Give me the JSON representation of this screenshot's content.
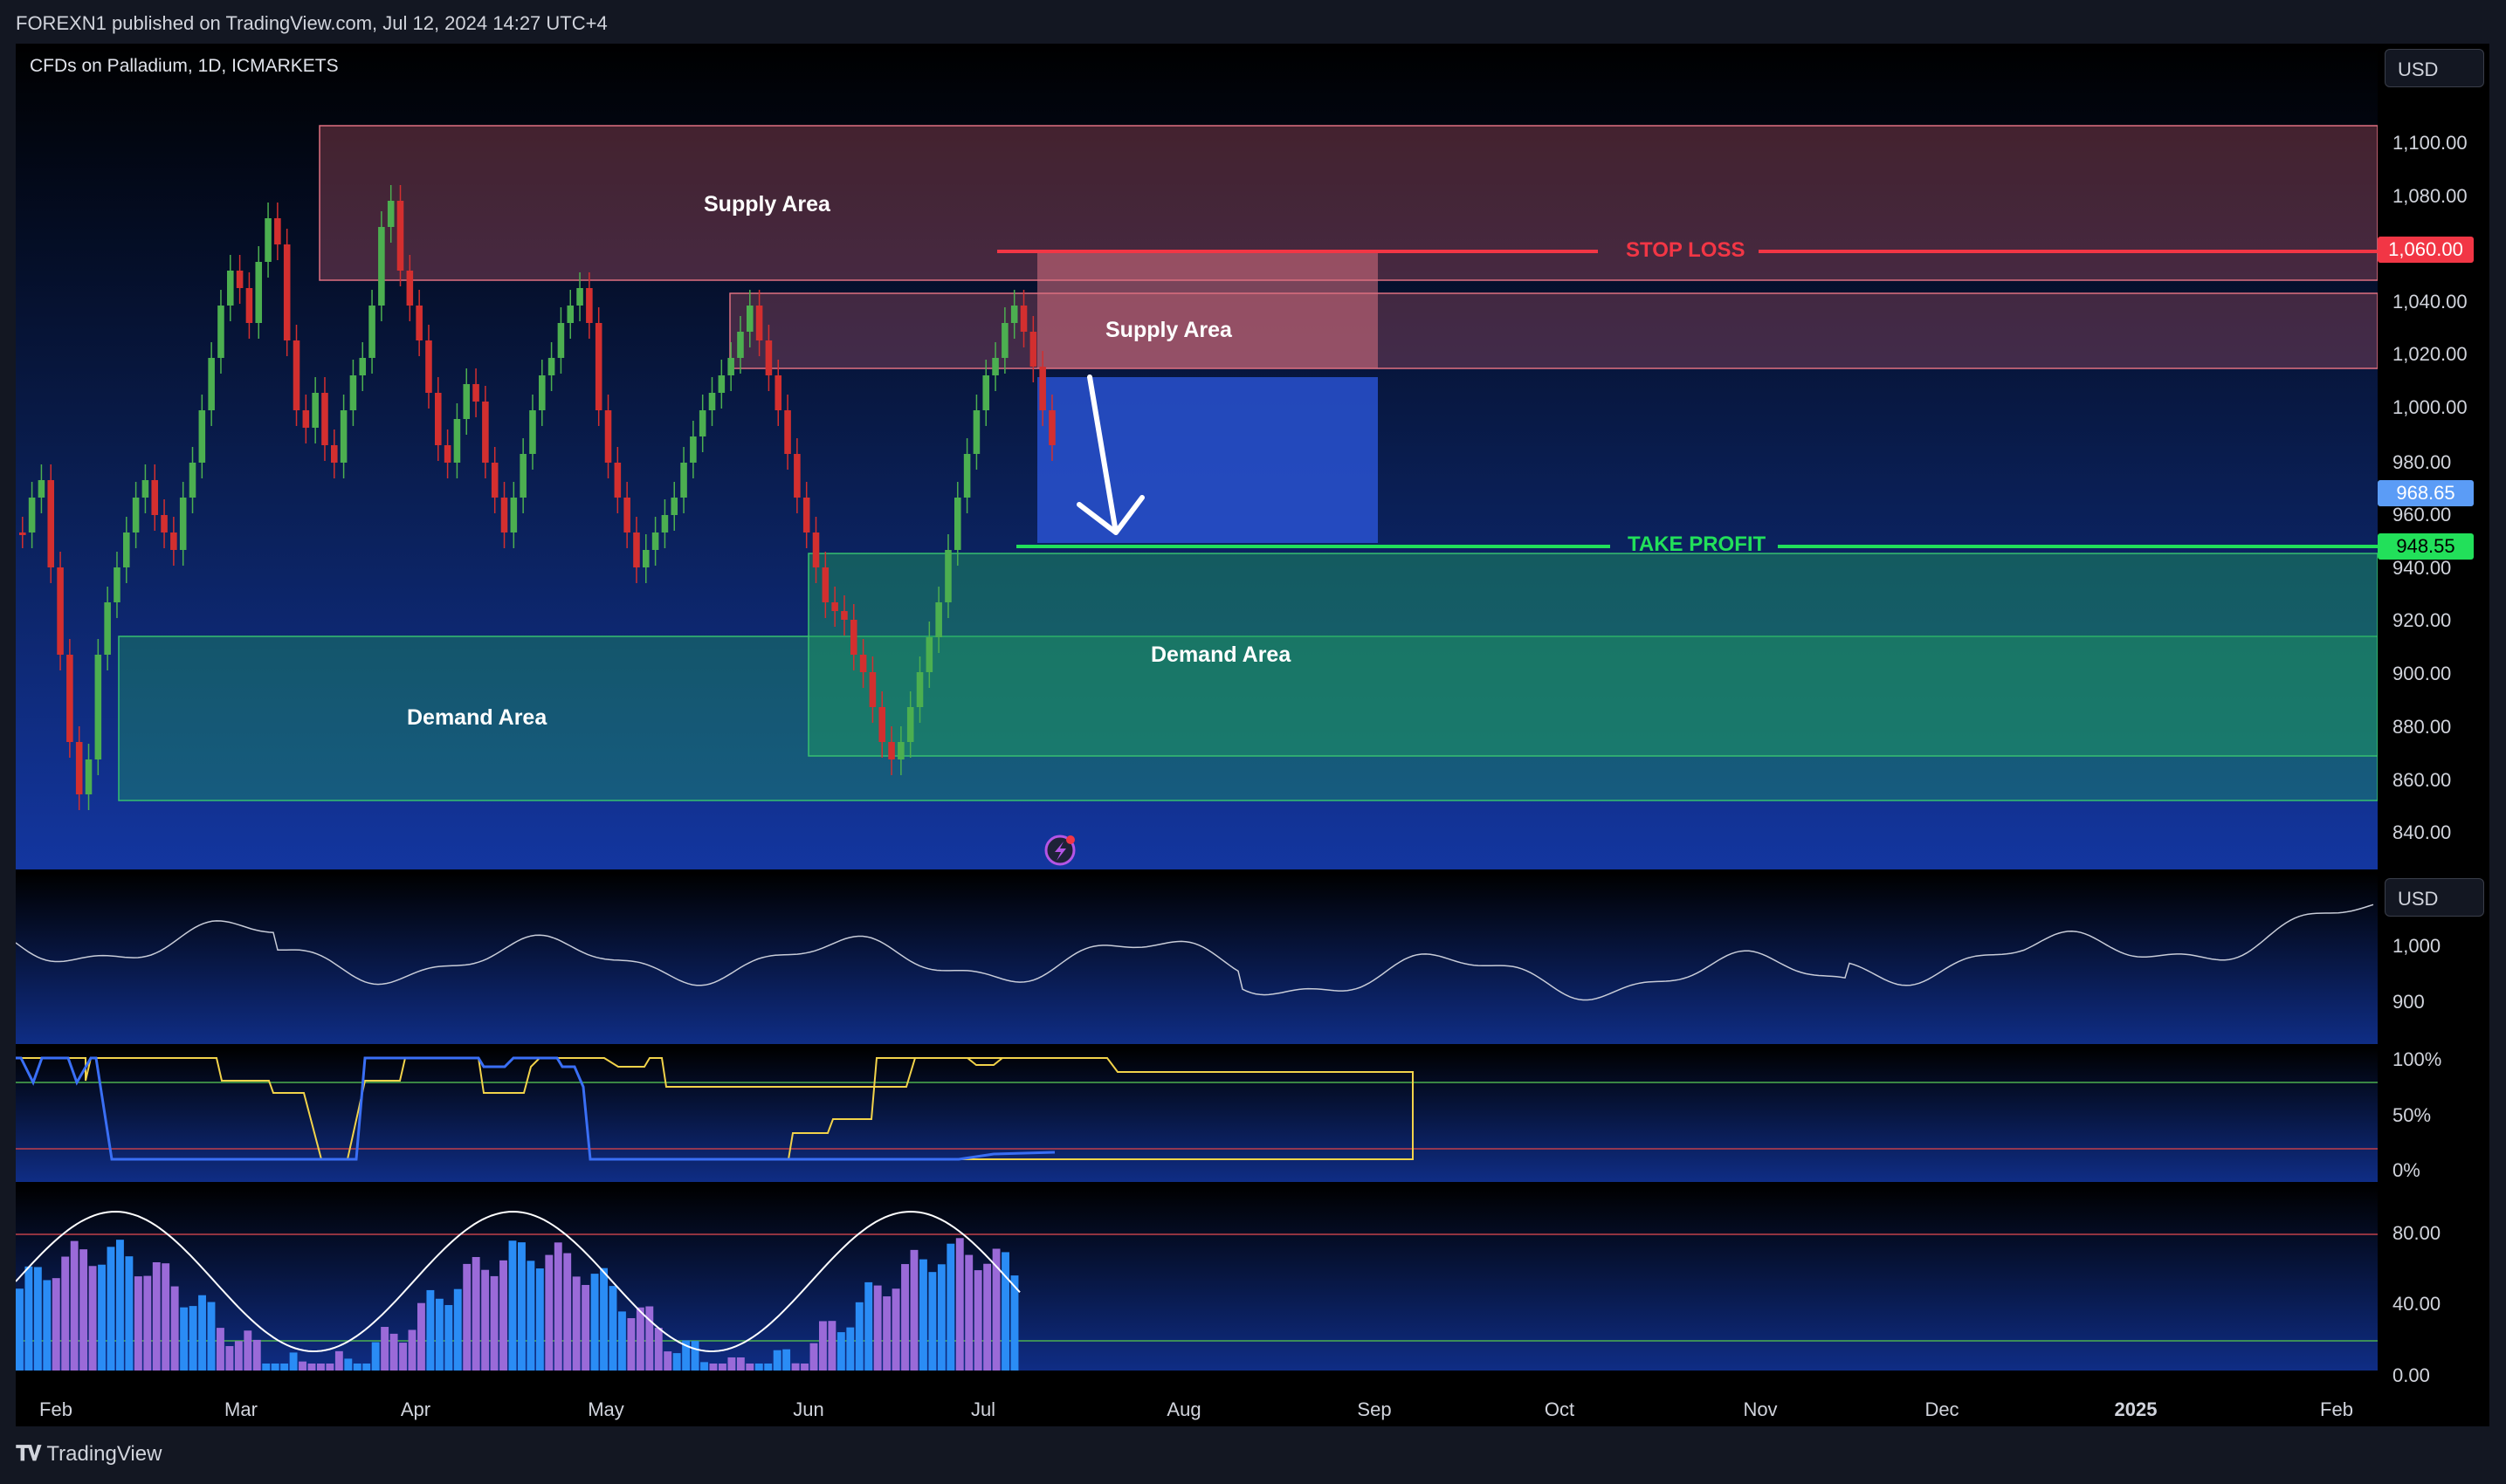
{
  "header": {
    "published": "FOREXN1 published on TradingView.com, Jul 12, 2024 14:27 UTC+4",
    "symbol": "CFDs on Palladium, 1D, ICMARKETS",
    "currency": "USD",
    "currency_ind": "USD"
  },
  "price_axis": {
    "labels": [
      "1,100.00",
      "1,080.00",
      "1,040.00",
      "1,020.00",
      "1,000.00",
      "980.00",
      "960.00",
      "940.00",
      "920.00",
      "900.00",
      "880.00",
      "860.00",
      "840.00"
    ],
    "badges": {
      "stop_loss": {
        "text": "1,060.00",
        "color": "#f23645"
      },
      "current": {
        "text": "968.65",
        "color": "#5b9cf6"
      },
      "take_profit": {
        "text": "948.55",
        "color": "#22e05a"
      }
    }
  },
  "chart": {
    "zones": {
      "supply_major": "Supply Area",
      "supply_minor": "Supply Area",
      "demand_left": "Demand Area",
      "demand_right": "Demand Area"
    },
    "levels": {
      "stop_loss": {
        "label": "STOP LOSS",
        "color": "#f23645"
      },
      "take_profit": {
        "label": "TAKE PROFIT",
        "color": "#22e05a"
      }
    },
    "colors": {
      "up": "#4caf50",
      "down": "#d32f2f",
      "supply": "#c05a6a",
      "demand": "#1fa060",
      "position": "#2a55d8"
    }
  },
  "indicators": {
    "ind1_labels": [
      "1,000",
      "900"
    ],
    "ind2_labels": [
      "100%",
      "50%",
      "0%"
    ],
    "ind3_labels": [
      "80.00",
      "40.00",
      "0.00"
    ]
  },
  "time_axis": {
    "labels": [
      "Feb",
      "Mar",
      "Apr",
      "May",
      "Jun",
      "Jul",
      "Aug",
      "Sep",
      "Oct",
      "Nov",
      "Dec",
      "2025",
      "Feb"
    ]
  },
  "footer": {
    "brand": "TradingView"
  }
}
